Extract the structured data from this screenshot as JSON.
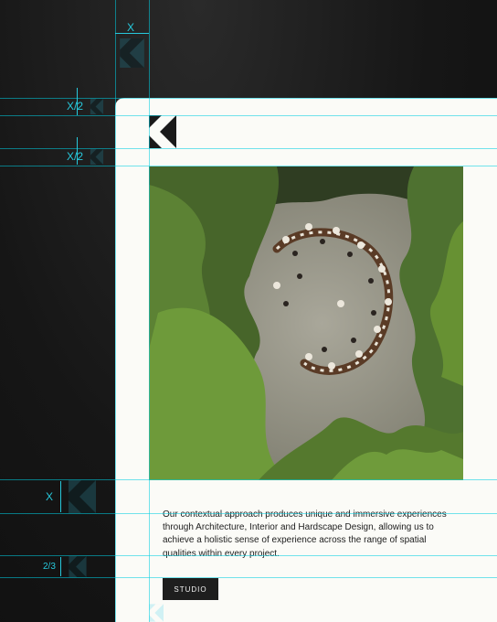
{
  "guides": {
    "top_width_label": "X",
    "half_label_1": "X/2",
    "half_label_2": "X/2",
    "bottom_x_label": "X",
    "two_thirds_label": "2/3"
  },
  "brand": {
    "logo_icon": "k-monogram-icon"
  },
  "content": {
    "photo_alt": "aerial view of people at long tables among pine trees",
    "paragraph": "Our contextual approach produces unique and immersive experiences through Architecture, Interior and Hardscape Design, allowing us to achieve a holistic sense of experience across the range of spatial qualities within every project.",
    "button_label": "STUDIO"
  },
  "colors": {
    "guide": "#00cde1",
    "card": "#fbfbf7",
    "button": "#1e1e1e",
    "background": "#161616"
  }
}
